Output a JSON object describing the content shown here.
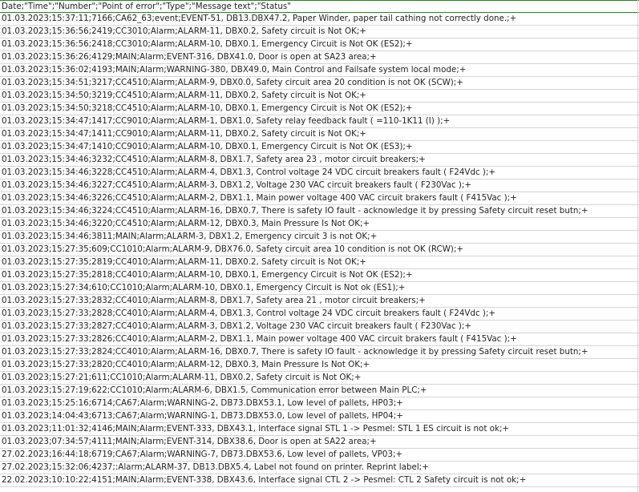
{
  "sheet": {
    "header": "Date;\"Time\";\"Number\";\"Point of error\";\"Type\";\"Message text\";\"Status\"",
    "rows": [
      "01.03.2023;15:37:11;7166;CA62_63;event;EVENT-51, DB13.DBX47.2, Paper Winder, paper tail cathing not correctly done.;+",
      "01.03.2023;15:36:56;2419;CC3010;Alarm;ALARM-11, DBX0.2, Safety circuit is Not OK;+",
      "01.03.2023;15:36:56;2418;CC3010;Alarm;ALARM-10, DBX0.1, Emergency Circuit is Not OK (ES2);+",
      "01.03.2023;15:36:26;4129;MAIN;Alarm;EVENT-316, DBX41.0, Door is open at SA23 area;+",
      "01.03.2023;15:36:02;4193;MAIN;Alarm;WARNING-380, DBX49.0, Main Control and Failsafe system local mode;+",
      "01.03.2023;15:34:51;3217;CC4510;Alarm;ALARM-9, DBX0.0, Safety circuit area 20 condition is not OK (SCW);+",
      "01.03.2023;15:34:50;3219;CC4510;Alarm;ALARM-11, DBX0.2, Safety circuit is Not OK;+",
      "01.03.2023;15:34:50;3218;CC4510;Alarm;ALARM-10, DBX0.1, Emergency Circuit is Not OK (ES2);+",
      "01.03.2023;15:34:47;1417;CC9010;Alarm;ALARM-1, DBX1.0, Safety relay feedback fault ( =110-1K11 (I) );+",
      "01.03.2023;15:34:47;1411;CC9010;Alarm;ALARM-11, DBX0.2, Safety circuit is Not OK;+",
      "01.03.2023;15:34:47;1410;CC9010;Alarm;ALARM-10, DBX0.1, Emergency Circuit is Not OK (ES3);+",
      "01.03.2023;15:34:46;3232;CC4510;Alarm;ALARM-8, DBX1.7, Safety area 23 , motor circuit breakers;+",
      "01.03.2023;15:34:46;3228;CC4510;Alarm;ALARM-4, DBX1.3, Control voltage 24 VDC circuit breakers fault ( F24Vdc );+",
      "01.03.2023;15:34:46;3227;CC4510;Alarm;ALARM-3, DBX1.2, Voltage 230 VAC circuit breakers fault ( F230Vac );+",
      "01.03.2023;15:34:46;3226;CC4510;Alarm;ALARM-2, DBX1.1, Main power voltage 400 VAC circuit brakers fault ( F415Vac );+",
      "01.03.2023;15:34:46;3224;CC4510;Alarm;ALARM-16, DBX0.7, There is safety IO fault - acknowledge it by pressing Safety circuit reset butn;+",
      "01.03.2023;15:34:46;3220;CC4510;Alarm;ALARM-12, DBX0.3, Main Pressure Is Not OK;+",
      "01.03.2023;15:34:46;3811;MAIN;Alarm;ALARM-3, DBX1.2, Emergency circuit 3 is not OK;+",
      "01.03.2023;15:27:35;609;CC1010;Alarm;ALARM-9, DBX76.0, Safety circuit area 10 condition is not OK (RCW);+",
      "01.03.2023;15:27:35;2819;CC4010;Alarm;ALARM-11, DBX0.2, Safety circuit is Not OK;+",
      "01.03.2023;15:27:35;2818;CC4010;Alarm;ALARM-10, DBX0.1, Emergency Circuit is Not OK (ES2);+",
      "01.03.2023;15:27:34;610;CC1010;Alarm;ALARM-10, DBX0.1, Emergency Circuit is Not ok (ES1);+",
      "01.03.2023;15:27:33;2832;CC4010;Alarm;ALARM-8, DBX1.7, Safety area 21 , motor circuit breakers;+",
      "01.03.2023;15:27:33;2828;CC4010;Alarm;ALARM-4, DBX1.3, Control voltage 24 VDC circuit breakers fault ( F24Vdc );+",
      "01.03.2023;15:27:33;2827;CC4010;Alarm;ALARM-3, DBX1.2, Voltage 230 VAC circuit breakers fault ( F230Vac );+",
      "01.03.2023;15:27:33;2826;CC4010;Alarm;ALARM-2, DBX1.1, Main power voltage 400 VAC circuit brakers fault ( F415Vac );+",
      "01.03.2023;15:27:33;2824;CC4010;Alarm;ALARM-16, DBX0.7, There is safety IO fault - acknowledge it by pressing Safety circuit reset butn;+",
      "01.03.2023;15:27:33;2820;CC4010;Alarm;ALARM-12, DBX0.3, Main Pressure Is Not OK;+",
      "01.03.2023;15:27:21;611;CC1010;Alarm;ALARM-11, DBX0.2, Safety circuit is Not OK;+",
      "01.03.2023;15:27:19;622;CC1010;Alarm;ALARM-6, DBX1.5, Communication error between Main PLC;+",
      "01.03.2023;15:25:16;6714;CA67;Alarm;WARNING-2, DB73.DBX53.1, Low level of pallets, HP03;+",
      "01.03.2023;14:04:43;6713;CA67;Alarm;WARNING-1, DB73.DBX53.0, Low level of pallets, HP04;+",
      "01.03.2023;11:01:32;4146;MAIN;Alarm;EVENT-333, DBX43.1, Interface signal STL 1 -> Pesmel: STL 1 ES circuit is not ok;+",
      "01.03.2023;07:34:57;4111;MAIN;Alarm;EVENT-314, DBX38.6, Door is open at SA22 area;+",
      "27.02.2023;16:44:18;6719;CA67;Alarm;WARNING-7, DB73.DBX53.6, Low level of pallets, VP03;+",
      "27.02.2023;15:32:06;4237;:Alarm;ALARM-37, DB13.DBX5.4, Label not found on printer. Reprint label;+",
      "22.02.2023;10:10:22;4151;MAIN;Alarm;EVENT-338, DBX43.6, Interface signal CTL 2 -> Pesmel: CTL 2 Safety circuit is not ok;+"
    ]
  }
}
